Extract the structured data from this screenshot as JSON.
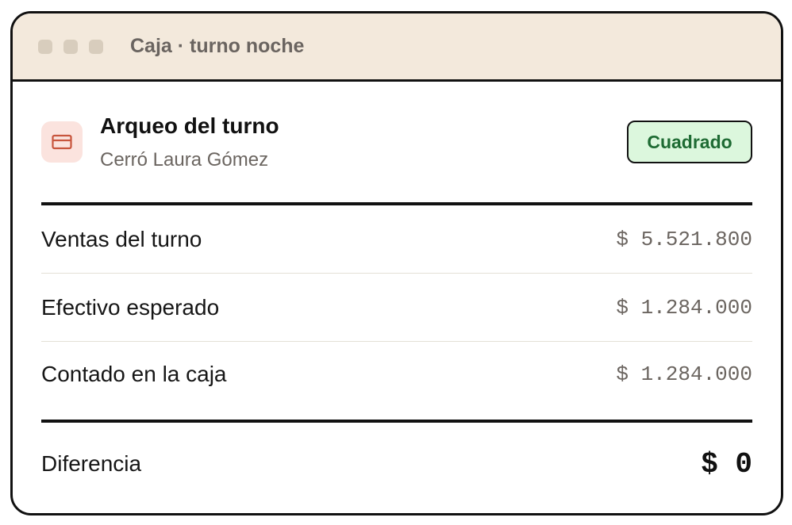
{
  "window": {
    "title": "Caja · turno noche"
  },
  "header": {
    "icon": "credit-card-icon",
    "title": "Arqueo del turno",
    "subtitle": "Cerró Laura Gómez",
    "status": "Cuadrado"
  },
  "rows": [
    {
      "label": "Ventas del turno",
      "value": "$ 5.521.800"
    },
    {
      "label": "Efectivo esperado",
      "value": "$ 1.284.000"
    },
    {
      "label": "Contado en la caja",
      "value": "$ 1.284.000"
    }
  ],
  "total": {
    "label": "Diferencia",
    "value": "$ 0"
  },
  "colors": {
    "titlebar": "#f3e9dc",
    "status_bg": "#dcf7dd",
    "status_text": "#1e6b33",
    "icon_accent": "#c8553d"
  }
}
